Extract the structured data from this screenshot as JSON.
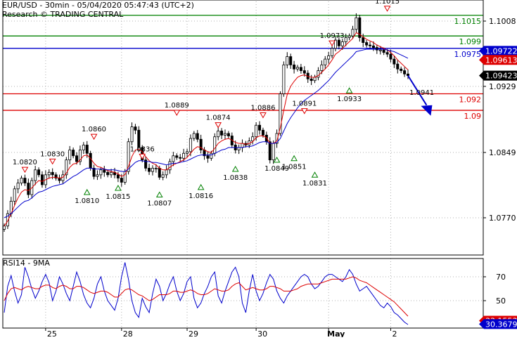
{
  "header": {
    "title": "EUR/USD - 30min - 05/04/2020 05:47:43 (UTC+2)",
    "subtitle": "Research © TRADING CENTRAL"
  },
  "colors": {
    "resistance": "#008000",
    "pivot": "#0000cc",
    "support": "#dd0000",
    "price": "#000000",
    "ma_fast": "#dd0000",
    "ma_slow": "#0000cc",
    "down_marker": "#dd0000",
    "up_marker": "#008000",
    "gridline": "#b0b0b0"
  },
  "chart_data": [
    {
      "type": "candlestick",
      "title": "EUR/USD - 30min - 05/04/2020 05:47:43 (UTC+2)",
      "subtitle": "Research © TRADING CENTRAL",
      "ylim": [
        1.0735,
        1.1035
      ],
      "grid": true,
      "y_ticks": [
        {
          "value": 1.1008,
          "label": "1.1008"
        },
        {
          "value": 1.0929,
          "label": "1.0929"
        },
        {
          "value": 1.0849,
          "label": "1.0849"
        },
        {
          "value": 1.077,
          "label": "1.0770"
        }
      ],
      "x_ticks": [
        {
          "index": 12,
          "label": "25"
        },
        {
          "index": 34,
          "label": "28"
        },
        {
          "index": 53,
          "label": "29"
        },
        {
          "index": 73,
          "label": "30"
        },
        {
          "index": 94,
          "label": "May"
        },
        {
          "index": 112,
          "label": "2"
        }
      ],
      "levels": [
        {
          "value": 1.1015,
          "label": "1.1015",
          "kind": "resistance"
        },
        {
          "value": 1.099,
          "label": "1.099",
          "kind": "resistance"
        },
        {
          "value": 1.0975,
          "label": "1.0975",
          "kind": "pivot"
        },
        {
          "value": 1.092,
          "label": "1.092",
          "kind": "support"
        },
        {
          "value": 1.09,
          "label": "1.09",
          "kind": "support"
        }
      ],
      "value_badges": [
        {
          "value": 1.0972,
          "label": "1.09722",
          "color": "#0000cc"
        },
        {
          "value": 1.0961,
          "label": "1.09613",
          "color": "#dd0000"
        },
        {
          "value": 1.0942,
          "label": "1.09423",
          "color": "#000000"
        }
      ],
      "series": [
        {
          "name": "Price",
          "kind": "close",
          "values": [
            1.076,
            1.0775,
            1.079,
            1.0805,
            1.0812,
            1.0818,
            1.0812,
            1.0798,
            1.0815,
            1.0828,
            1.0822,
            1.081,
            1.0822,
            1.0825,
            1.0822,
            1.0818,
            1.0815,
            1.0822,
            1.084,
            1.0852,
            1.0845,
            1.0838,
            1.0852,
            1.0858,
            1.0848,
            1.083,
            1.082,
            1.0822,
            1.0828,
            1.0825,
            1.0822,
            1.0825,
            1.0822,
            1.0818,
            1.0813,
            1.0826,
            1.0862,
            1.088,
            1.0876,
            1.0855,
            1.084,
            1.083,
            1.0826,
            1.083,
            1.083,
            1.0819,
            1.0822,
            1.0828,
            1.0838,
            1.0845,
            1.0843,
            1.0842,
            1.0848,
            1.085,
            1.0866,
            1.0872,
            1.0865,
            1.0852,
            1.0845,
            1.0842,
            1.0848,
            1.0868,
            1.0875,
            1.087,
            1.0872,
            1.0869,
            1.0858,
            1.0852,
            1.0855,
            1.086,
            1.0858,
            1.0863,
            1.0868,
            1.0882,
            1.0876,
            1.087,
            1.0862,
            1.084,
            1.086,
            1.0872,
            1.092,
            1.0955,
            1.0965,
            1.0955,
            1.095,
            1.0952,
            1.0948,
            1.0945,
            1.0938,
            1.0936,
            1.094,
            1.0948,
            1.0955,
            1.0962,
            1.0966,
            1.0975,
            1.0985,
            1.0978,
            1.0983,
            1.0988,
            1.099,
            1.0998,
            1.1012,
            1.0988,
            1.0982,
            1.0979,
            1.0978,
            1.0976,
            1.0973,
            1.0973,
            1.097,
            1.0968,
            1.0962,
            1.0956,
            1.095,
            1.0948,
            1.0944,
            1.0942
          ]
        },
        {
          "name": "MA fast",
          "kind": "overlay",
          "values": [
            1.076,
            1.0766,
            1.0775,
            1.0785,
            1.0794,
            1.0801,
            1.0804,
            1.0803,
            1.0806,
            1.0811,
            1.0815,
            1.0814,
            1.0816,
            1.0818,
            1.0819,
            1.0819,
            1.0818,
            1.0819,
            1.0824,
            1.0831,
            1.0835,
            1.0836,
            1.084,
            1.0845,
            1.0846,
            1.0842,
            1.0836,
            1.0832,
            1.0831,
            1.0829,
            1.0827,
            1.0826,
            1.0825,
            1.0823,
            1.082,
            1.0822,
            1.0832,
            1.0844,
            1.0852,
            1.0853,
            1.085,
            1.0844,
            1.0839,
            1.0836,
            1.0834,
            1.083,
            1.0828,
            1.0828,
            1.0831,
            1.0834,
            1.0836,
            1.0838,
            1.084,
            1.0843,
            1.0848,
            1.0853,
            1.0856,
            1.0855,
            1.0852,
            1.085,
            1.0849,
            1.0854,
            1.086,
            1.0863,
            1.0865,
            1.0866,
            1.0864,
            1.0861,
            1.086,
            1.086,
            1.0859,
            1.086,
            1.0862,
            1.0867,
            1.0869,
            1.0869,
            1.0867,
            1.086,
            1.086,
            1.0863,
            1.0879,
            1.09,
            1.0919,
            1.0929,
            1.0935,
            1.094,
            1.0942,
            1.0943,
            1.0941,
            1.094,
            1.094,
            1.0942,
            1.0946,
            1.095,
            1.0955,
            1.0961,
            1.0968,
            1.0971,
            1.0975,
            1.0979,
            1.0983,
            1.0987,
            1.0994,
            1.0992,
            1.0989,
            1.0986,
            1.0984,
            1.0982,
            1.0979,
            1.0977,
            1.0975,
            1.0973,
            1.097,
            1.0966,
            1.0961,
            1.0957,
            1.0953,
            1.0949
          ]
        },
        {
          "name": "MA slow",
          "kind": "overlay",
          "values": [
            1.077,
            1.0772,
            1.0775,
            1.0779,
            1.0783,
            1.0787,
            1.079,
            1.0791,
            1.0794,
            1.0798,
            1.0801,
            1.0802,
            1.0804,
            1.0806,
            1.0808,
            1.0809,
            1.081,
            1.0811,
            1.0814,
            1.0817,
            1.082,
            1.0822,
            1.0825,
            1.0828,
            1.083,
            1.083,
            1.0829,
            1.0829,
            1.0829,
            1.0829,
            1.0828,
            1.0828,
            1.0828,
            1.0827,
            1.0826,
            1.0826,
            1.0829,
            1.0833,
            1.0837,
            1.0839,
            1.0839,
            1.0838,
            1.0838,
            1.0837,
            1.0837,
            1.0836,
            1.0835,
            1.0834,
            1.0835,
            1.0836,
            1.0836,
            1.0837,
            1.0838,
            1.0839,
            1.0841,
            1.0843,
            1.0845,
            1.0846,
            1.0846,
            1.0846,
            1.0846,
            1.0848,
            1.085,
            1.0852,
            1.0853,
            1.0855,
            1.0855,
            1.0855,
            1.0855,
            1.0855,
            1.0856,
            1.0856,
            1.0857,
            1.0859,
            1.0861,
            1.0862,
            1.0862,
            1.086,
            1.086,
            1.0861,
            1.0866,
            1.0875,
            1.0884,
            1.0891,
            1.0897,
            1.0903,
            1.0908,
            1.0912,
            1.0915,
            1.0918,
            1.0921,
            1.0924,
            1.0928,
            1.0932,
            1.0936,
            1.0941,
            1.0946,
            1.095,
            1.0954,
            1.0958,
            1.0962,
            1.0966,
            1.0971,
            1.0972,
            1.0973,
            1.0974,
            1.0974,
            1.0974,
            1.0974,
            1.0974,
            1.0974,
            1.0973,
            1.0972,
            1.0971,
            1.0969,
            1.0967,
            1.0965,
            1.0963
          ]
        }
      ],
      "forecast": {
        "from_index": 117,
        "to_index": 123,
        "from_value": 1.0942,
        "to_value": 1.0902
      },
      "annotations": [
        {
          "label": "1.0820",
          "index": 6,
          "value": 1.082,
          "marker": "down",
          "label_side": "above"
        },
        {
          "label": "1.0830",
          "index": 14,
          "value": 1.083,
          "marker": "down",
          "label_side": "above"
        },
        {
          "label": "1.0810",
          "index": 24,
          "value": 1.081,
          "marker": "up",
          "label_side": "below"
        },
        {
          "label": "1.0860",
          "index": 26,
          "value": 1.086,
          "marker": "down",
          "label_side": "above"
        },
        {
          "label": "1.0815",
          "index": 33,
          "value": 1.0815,
          "marker": "up",
          "label_side": "below"
        },
        {
          "label": "1.0836",
          "index": 40,
          "value": 1.0836,
          "marker": "down",
          "label_side": "above"
        },
        {
          "label": "1.0807",
          "index": 45,
          "value": 1.0807,
          "marker": "up",
          "label_side": "below"
        },
        {
          "label": "1.0889",
          "index": 50,
          "value": 1.0889,
          "marker": "down",
          "label_side": "above"
        },
        {
          "label": "1.0816",
          "index": 57,
          "value": 1.0816,
          "marker": "up",
          "label_side": "below"
        },
        {
          "label": "1.0874",
          "index": 62,
          "value": 1.0874,
          "marker": "down",
          "label_side": "above"
        },
        {
          "label": "1.0838",
          "index": 67,
          "value": 1.0838,
          "marker": "up",
          "label_side": "below"
        },
        {
          "label": "1.0886",
          "index": 75,
          "value": 1.0886,
          "marker": "down",
          "label_side": "above"
        },
        {
          "label": "1.0849",
          "index": 79,
          "value": 1.0849,
          "marker": "up",
          "label_side": "below"
        },
        {
          "label": "1.0851",
          "index": 84,
          "value": 1.0851,
          "marker": "up",
          "label_side": "below"
        },
        {
          "label": "1.0891",
          "index": 87,
          "value": 1.0891,
          "marker": "down",
          "label_side": "above"
        },
        {
          "label": "1.0831",
          "index": 90,
          "value": 1.0831,
          "marker": "up",
          "label_side": "below"
        },
        {
          "label": "1.0973",
          "index": 95,
          "value": 1.0973,
          "marker": "down",
          "label_side": "above"
        },
        {
          "label": "1.0933",
          "index": 100,
          "value": 1.0933,
          "marker": "up",
          "label_side": "below"
        },
        {
          "label": "1.1015",
          "index": 111,
          "value": 1.1015,
          "marker": "down",
          "label_side": "above"
        },
        {
          "label": "1.0941",
          "index": 121,
          "value": 1.0941,
          "marker": "none",
          "label_side": "below"
        }
      ]
    },
    {
      "type": "line",
      "title": "RSI14 - 9MA",
      "ylim": [
        25,
        95
      ],
      "grid": true,
      "y_ticks": [
        {
          "value": 70,
          "label": "70"
        },
        {
          "value": 50,
          "label": "50"
        }
      ],
      "value_badges": [
        {
          "value": 33.2,
          "label": "33.1553",
          "color": "#dd0000"
        },
        {
          "value": 30.4,
          "label": "30.3679",
          "color": "#0000cc"
        }
      ],
      "series": [
        {
          "name": "RSI14",
          "values": [
            40,
            62,
            71,
            58,
            48,
            55,
            78,
            70,
            60,
            52,
            58,
            66,
            72,
            65,
            50,
            58,
            70,
            64,
            56,
            50,
            62,
            74,
            66,
            55,
            48,
            44,
            52,
            64,
            70,
            58,
            50,
            46,
            42,
            52,
            70,
            82,
            68,
            50,
            40,
            36,
            52,
            45,
            40,
            56,
            68,
            62,
            50,
            56,
            64,
            70,
            58,
            50,
            56,
            66,
            70,
            52,
            44,
            48,
            56,
            62,
            70,
            74,
            54,
            48,
            58,
            66,
            74,
            78,
            70,
            48,
            40,
            58,
            72,
            58,
            50,
            56,
            65,
            72,
            68,
            58,
            52,
            48,
            54,
            58,
            62,
            66,
            70,
            72,
            70,
            64,
            60,
            62,
            66,
            70,
            72,
            72,
            70,
            68,
            66,
            70,
            76,
            72,
            64,
            58,
            60,
            62,
            58,
            54,
            50,
            46,
            44,
            48,
            45,
            40,
            38,
            35,
            32,
            30
          ]
        },
        {
          "name": "9MA",
          "values": [
            50,
            56,
            60,
            61,
            60,
            59,
            61,
            62,
            61,
            60,
            60,
            62,
            63,
            63,
            61,
            60,
            62,
            63,
            62,
            60,
            60,
            62,
            62,
            61,
            59,
            57,
            56,
            57,
            58,
            58,
            57,
            55,
            53,
            53,
            56,
            59,
            60,
            59,
            57,
            55,
            54,
            52,
            50,
            51,
            53,
            55,
            55,
            55,
            56,
            58,
            58,
            57,
            57,
            58,
            59,
            58,
            56,
            55,
            55,
            56,
            58,
            60,
            59,
            58,
            58,
            59,
            62,
            64,
            65,
            62,
            59,
            60,
            61,
            60,
            59,
            59,
            60,
            62,
            62,
            61,
            60,
            58,
            58,
            58,
            59,
            60,
            62,
            63,
            64,
            64,
            64,
            64,
            65,
            66,
            67,
            68,
            68,
            68,
            68,
            68,
            69,
            70,
            69,
            67,
            66,
            65,
            63,
            61,
            59,
            57,
            55,
            53,
            51,
            49,
            46,
            43,
            40,
            37
          ]
        }
      ]
    }
  ]
}
